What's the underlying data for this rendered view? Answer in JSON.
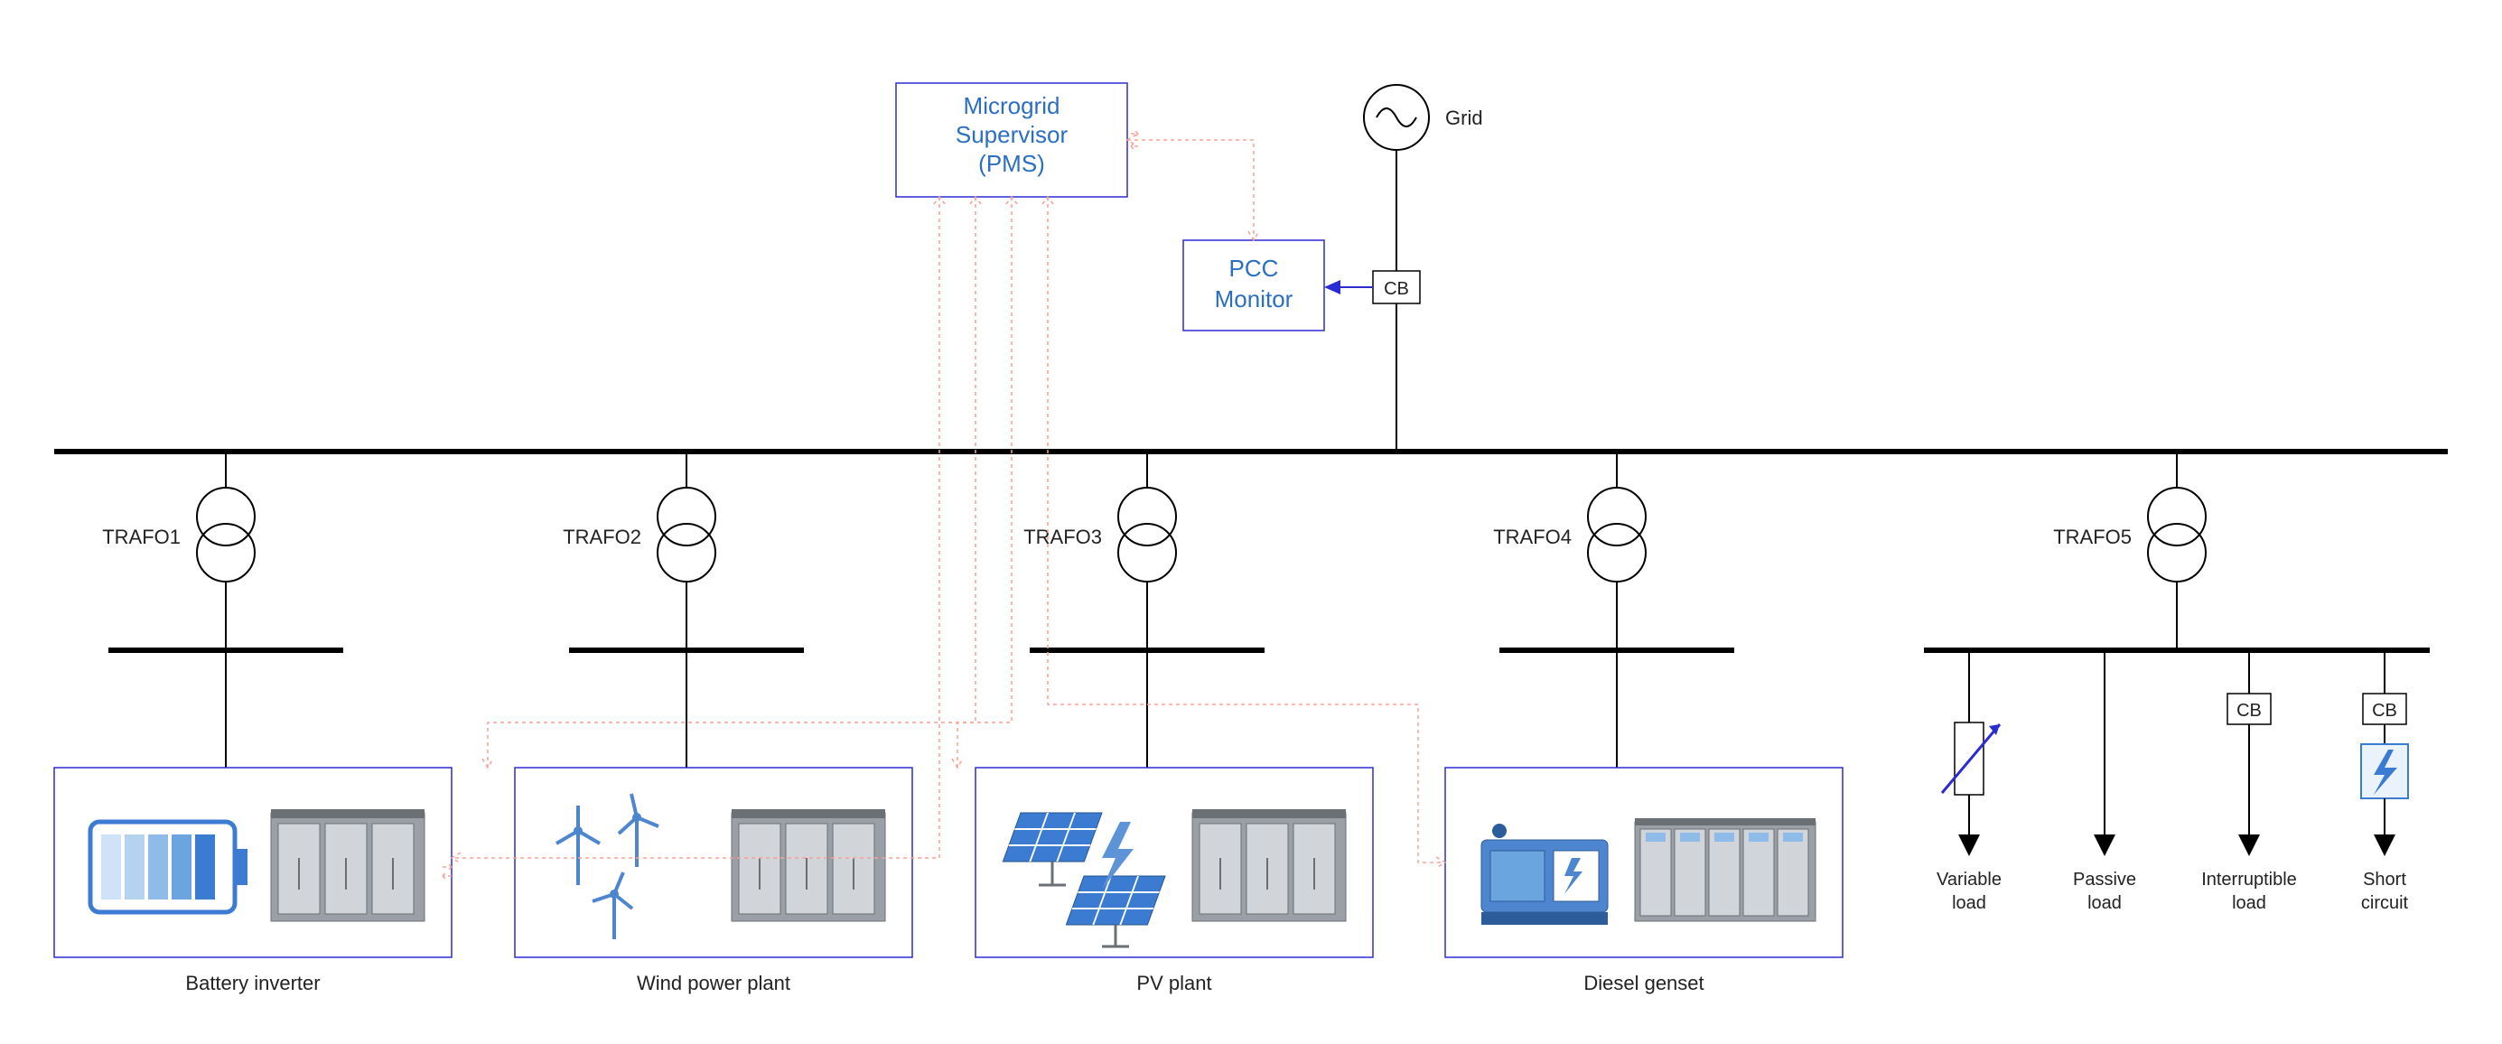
{
  "top": {
    "supervisor_l1": "Microgrid",
    "supervisor_l2": "Supervisor",
    "supervisor_l3": "(PMS)",
    "pcc_l1": "PCC",
    "pcc_l2": "Monitor",
    "grid": "Grid",
    "cb": "CB"
  },
  "trafos": {
    "t1": "TRAFO1",
    "t2": "TRAFO2",
    "t3": "TRAFO3",
    "t4": "TRAFO4",
    "t5": "TRAFO5"
  },
  "plants": {
    "battery": "Battery inverter",
    "wind": "Wind power plant",
    "pv": "PV plant",
    "diesel": "Diesel genset"
  },
  "loads": {
    "var_l1": "Variable",
    "var_l2": "load",
    "pas_l1": "Passive",
    "pas_l2": "load",
    "int_l1": "Interruptible",
    "int_l2": "load",
    "sc_l1": "Short",
    "sc_l2": "circuit",
    "cb": "CB"
  }
}
